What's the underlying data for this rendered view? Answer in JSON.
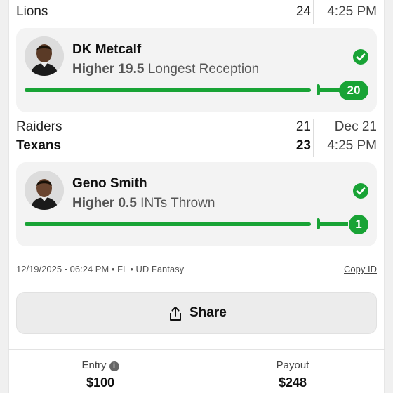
{
  "game1": {
    "teams": [
      {
        "name": "Lions",
        "score": "24",
        "winner": false
      }
    ],
    "time": "4:25 PM"
  },
  "pick1": {
    "player": "DK Metcalf",
    "direction": "Higher",
    "line": "19.5",
    "stat": "Longest Reception",
    "result": "20",
    "status": "won"
  },
  "game2": {
    "teams": [
      {
        "name": "Raiders",
        "score": "21",
        "winner": false
      },
      {
        "name": "Texans",
        "score": "23",
        "winner": true
      }
    ],
    "date": "Dec 21",
    "time": "4:25 PM"
  },
  "pick2": {
    "player": "Geno Smith",
    "direction": "Higher",
    "line": "0.5",
    "stat": "INTs Thrown",
    "result": "1",
    "status": "won"
  },
  "footer": {
    "meta": "12/19/2025 - 06:24 PM • FL • UD Fantasy",
    "copy_id": "Copy ID",
    "share_label": "Share"
  },
  "summary": {
    "entry_label": "Entry",
    "entry_value": "$100",
    "payout_label": "Payout",
    "payout_value": "$248"
  },
  "colors": {
    "success": "#18a335",
    "card_bg": "#f3f3f3"
  },
  "icons": [
    "check-circle-icon",
    "share-icon",
    "info-icon"
  ]
}
